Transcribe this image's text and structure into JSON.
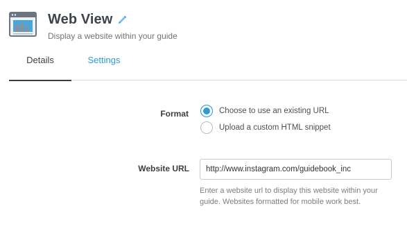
{
  "header": {
    "title": "Web View",
    "subtitle": "Display a website within your guide",
    "icon": "browser-window-icon",
    "edit_icon": "pencil-icon"
  },
  "tabs": [
    {
      "label": "Details",
      "active": true
    },
    {
      "label": "Settings",
      "active": false
    }
  ],
  "form": {
    "format": {
      "label": "Format",
      "options": [
        {
          "label": "Choose to use an existing URL",
          "selected": true
        },
        {
          "label": "Upload a custom HTML snippet",
          "selected": false
        }
      ]
    },
    "website_url": {
      "label": "Website URL",
      "value": "http://www.instagram.com/guidebook_inc",
      "help": "Enter a website url to display this website within your guide. Websites formatted for mobile work best."
    }
  },
  "colors": {
    "accent": "#2f9bd6",
    "text": "#3a3f44",
    "muted": "#7a7f84",
    "divider": "#d9dcdf"
  }
}
